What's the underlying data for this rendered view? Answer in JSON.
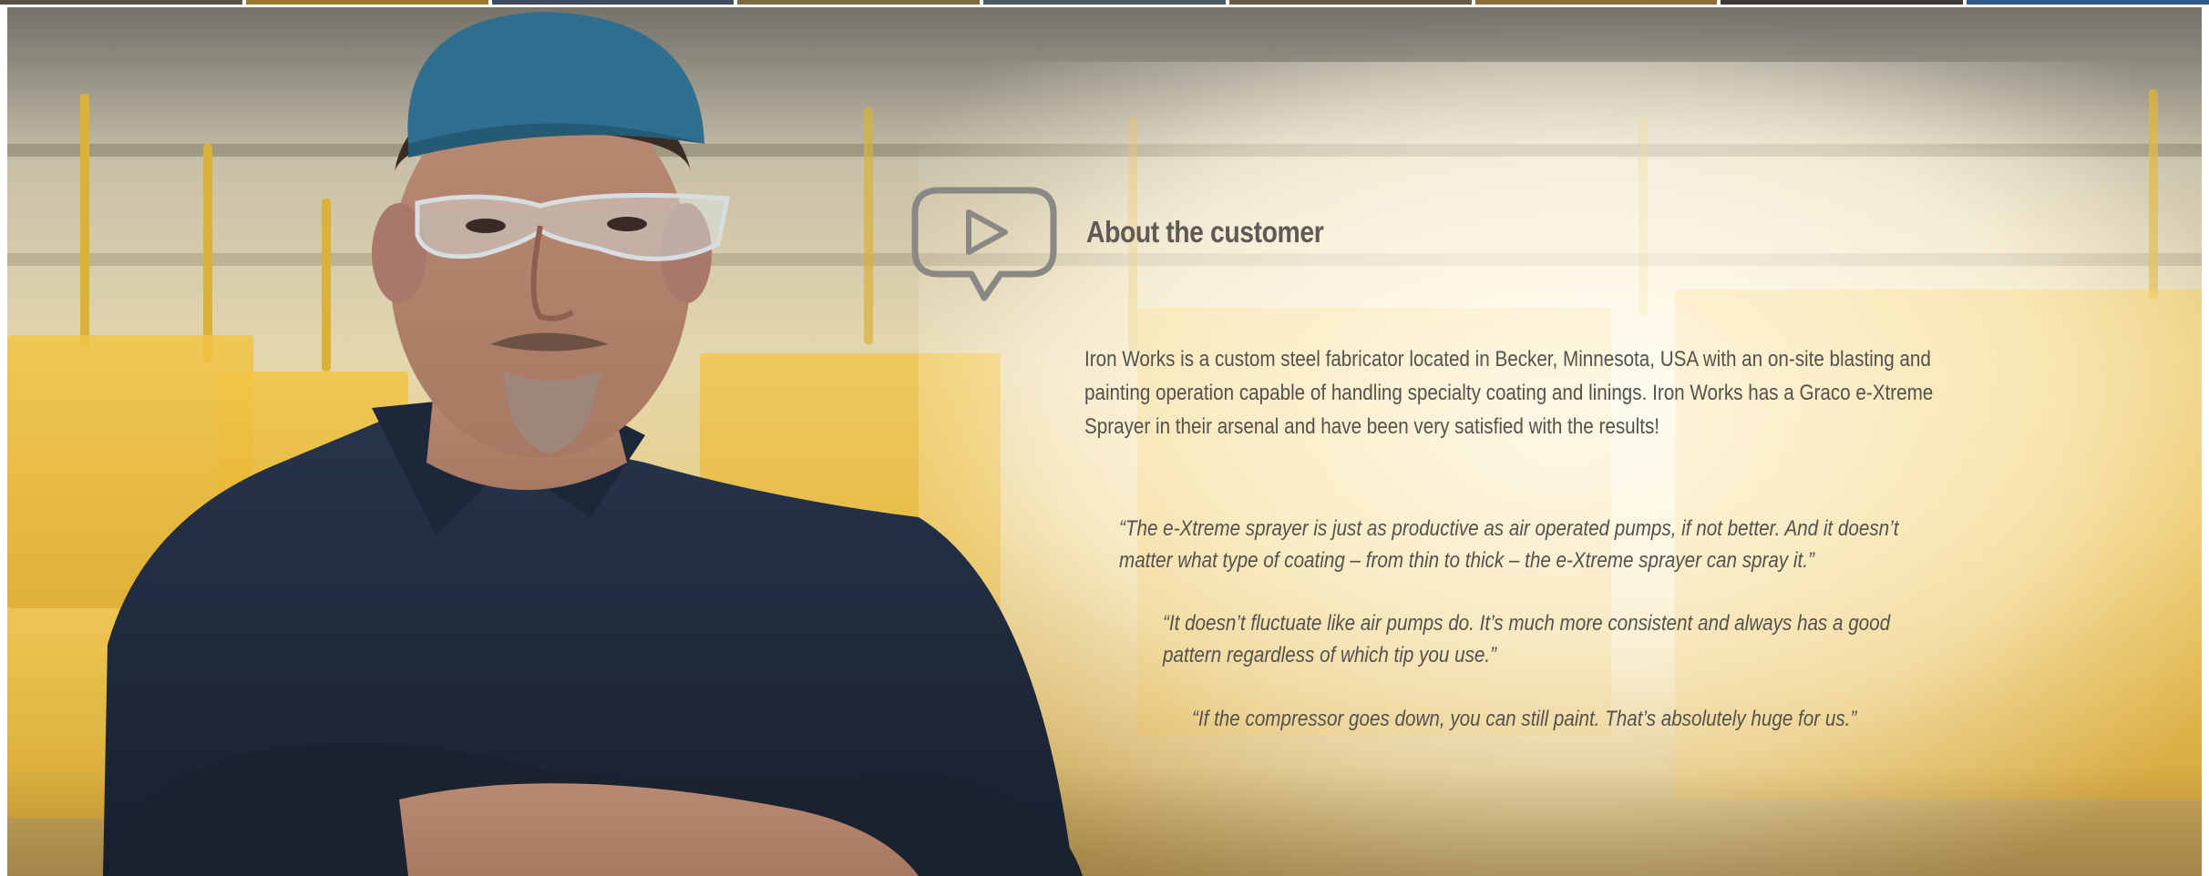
{
  "thumbnail_strip": {
    "thumbs": [
      {
        "color": "#5b5446"
      },
      {
        "color": "#9a7a2c"
      },
      {
        "color": "#3e4d5c"
      },
      {
        "color": "#7d6a3f"
      },
      {
        "color": "#4a5a66"
      },
      {
        "color": "#6b5c45"
      },
      {
        "color": "#8c6b34"
      },
      {
        "color": "#3f3b36"
      },
      {
        "color": "#2f5a8a"
      }
    ]
  },
  "video": {
    "icon": "play-speech-bubble-icon",
    "icon_color": "#8a8884"
  },
  "about": {
    "title": "About the customer",
    "description": "Iron Works is a custom steel fabricator located in Becker, Minnesota, USA with an on-site blasting and painting operation capable of handling specialty coating and linings. Iron Works has a Graco e-Xtreme Sprayer in their arsenal and have been very satisfied with the results!"
  },
  "quotes": [
    "“The e-Xtreme sprayer is just as productive as air operated pumps, if not better. And it doesn’t matter what type of coating – from thin to thick – the e-Xtreme sprayer can spray it.”",
    "“It doesn’t fluctuate like air pumps do. It’s much more consistent and always has a good pattern regardless of which tip you use.”",
    "“If the compressor goes down, you can still paint. That’s absolutely huge for us.”"
  ],
  "colors": {
    "text": "#55514c",
    "title": "#5e5a55",
    "shirt": "#1f2a3a",
    "cap": "#2f6e8e",
    "panel_yellow": "#f2c545"
  }
}
